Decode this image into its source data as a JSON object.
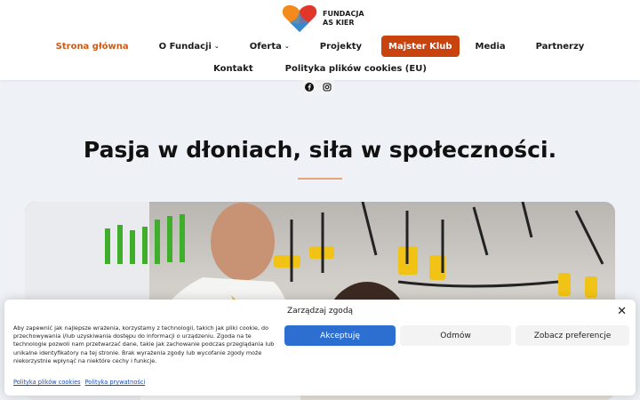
{
  "logo": {
    "line1": "FUNDACJA",
    "line2": "AS KIER"
  },
  "nav": {
    "row1": [
      {
        "label": "Strona główna",
        "active": true
      },
      {
        "label": "O Fundacji",
        "dropdown": true
      },
      {
        "label": "Oferta",
        "dropdown": true
      },
      {
        "label": "Projekty"
      },
      {
        "label": "Majster Klub",
        "highlight": true
      },
      {
        "label": "Media"
      },
      {
        "label": "Partnerzy"
      }
    ],
    "row2": [
      {
        "label": "Kontakt"
      },
      {
        "label": "Polityka plików cookies (EU)"
      }
    ]
  },
  "social": [
    "facebook-icon",
    "instagram-icon"
  ],
  "hero": {
    "title": "Pasja w dłoniach, siła w społeczności."
  },
  "cookie": {
    "title": "Zarządzaj zgodą",
    "text": "Aby zapewnić jak najlepsze wrażenia, korzystamy z technologii, takich jak pliki cookie, do przechowywania i/lub uzyskiwania dostępu do informacji o urządzeniu. Zgoda na te technologie pozwoli nam przetwarzać dane, takie jak zachowanie podczas przeglądania lub unikalne identyfikatory na tej stronie. Brak wyrażenia zgody lub wycofanie zgody może niekorzystnie wpłynąć na niektóre cechy i funkcje.",
    "accept": "Akceptuję",
    "deny": "Odmów",
    "prefs": "Zobacz preferencje",
    "link1": "Polityka plików cookies",
    "link2": "Polityka prywatności"
  },
  "colors": {
    "brand_orange": "#c8430e",
    "active_nav": "#d05a1a",
    "accept_blue": "#2d6fd0"
  }
}
